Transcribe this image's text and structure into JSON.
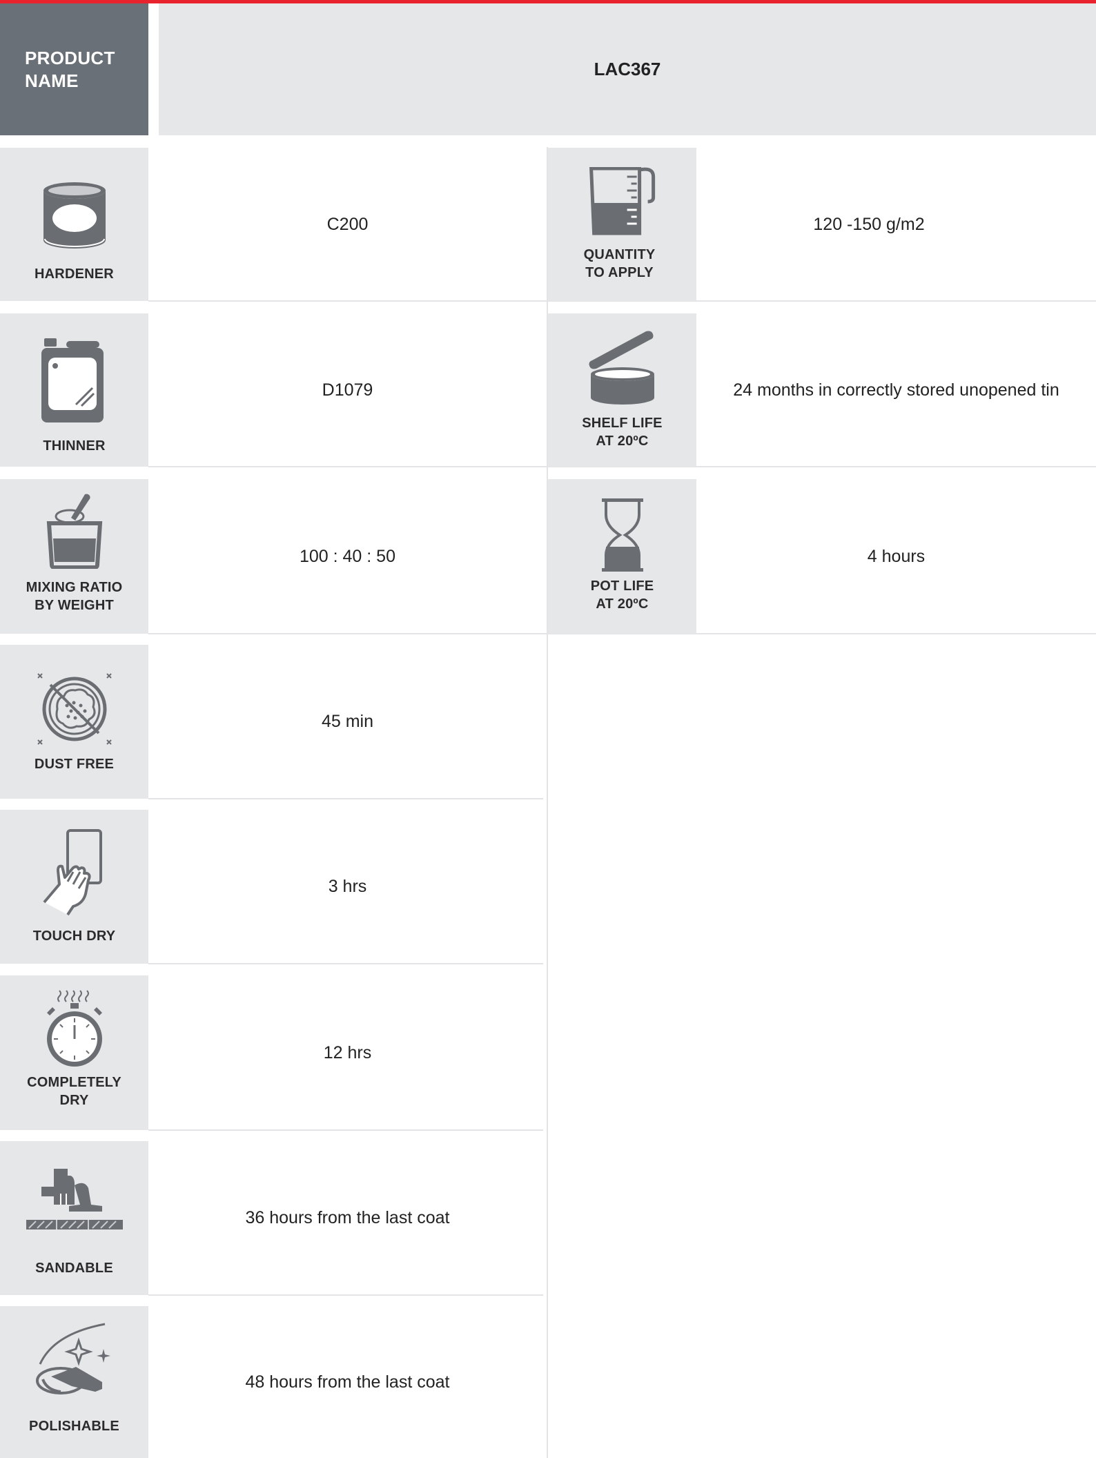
{
  "product": {
    "label_line1": "PRODUCT",
    "label_line2": "NAME",
    "name": "LAC367"
  },
  "colors": {
    "accent": "#e8232d",
    "header_dark": "#6a7077",
    "panel": "#e6e7e9",
    "icon": "#6a6e73"
  },
  "left": {
    "hardener": {
      "label1": "HARDENER",
      "value": "C200",
      "icon": "paint-can-icon"
    },
    "thinner": {
      "label1": "THINNER",
      "value": "D1079",
      "icon": "jerrycan-icon"
    },
    "mixing": {
      "label1": "MIXING RATIO",
      "label2": "BY WEIGHT",
      "value": "100 : 40 : 50",
      "icon": "mixing-bucket-icon"
    },
    "dust": {
      "label1": "DUST FREE",
      "value": "45 min",
      "icon": "dust-free-icon"
    },
    "touch": {
      "label1": "TOUCH DRY",
      "value": "3 hrs",
      "icon": "touch-dry-hand-icon"
    },
    "complete": {
      "label1": "COMPLETELY",
      "label2": "DRY",
      "value": "12 hrs",
      "icon": "stopwatch-icon"
    },
    "sandable": {
      "label1": "SANDABLE",
      "value": "36 hours from the last coat",
      "icon": "sander-icon"
    },
    "polishable": {
      "label1": "POLISHABLE",
      "value": "48 hours from the last coat",
      "icon": "polisher-icon"
    }
  },
  "right": {
    "quantity": {
      "label1": "QUANTITY",
      "label2": "TO APPLY",
      "value": "120 -150 g/m2",
      "icon": "measuring-jug-icon"
    },
    "shelf": {
      "label1": "SHELF LIFE",
      "label2": "AT 20ºC",
      "value": "24 months in correctly stored unopened tin",
      "icon": "open-tin-icon"
    },
    "pot": {
      "label1": "POT LIFE",
      "label2": "AT 20ºC",
      "value": "4 hours",
      "icon": "hourglass-icon"
    }
  }
}
